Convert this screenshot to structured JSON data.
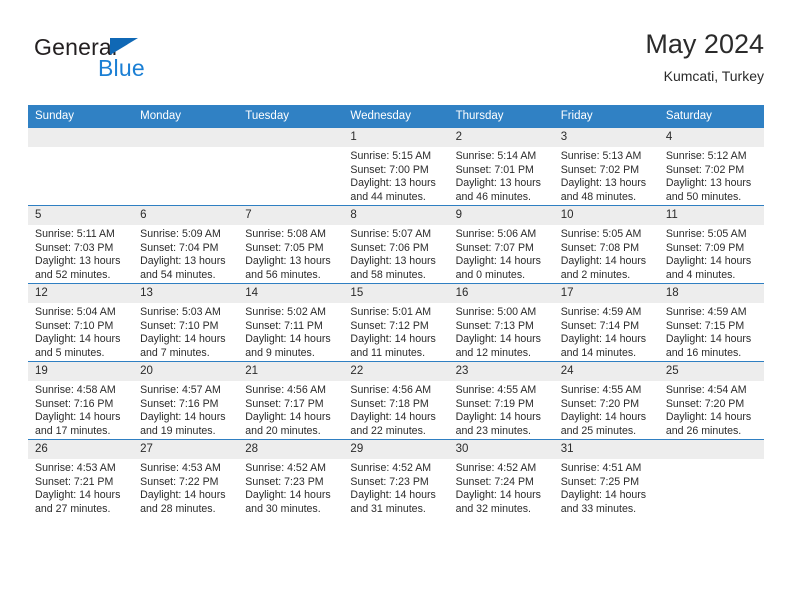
{
  "brand": {
    "name_top": "General",
    "name_bottom": "Blue",
    "accent_color": "#1b7fd4",
    "triangle_color": "#1068b5",
    "triangle_icon": "triangle-icon"
  },
  "header": {
    "title": "May 2024",
    "subtitle": "Kumcati, Turkey"
  },
  "calendar": {
    "header_bg": "#3081c4",
    "header_text_color": "#ffffff",
    "daynum_bg": "#ededed",
    "row_border_color": "#2f7fc2",
    "weekdays": [
      "Sunday",
      "Monday",
      "Tuesday",
      "Wednesday",
      "Thursday",
      "Friday",
      "Saturday"
    ],
    "weeks": [
      [
        {
          "day": "",
          "empty": true
        },
        {
          "day": "",
          "empty": true
        },
        {
          "day": "",
          "empty": true
        },
        {
          "day": "1",
          "sunrise": "Sunrise: 5:15 AM",
          "sunset": "Sunset: 7:00 PM",
          "daylight1": "Daylight: 13 hours",
          "daylight2": "and 44 minutes."
        },
        {
          "day": "2",
          "sunrise": "Sunrise: 5:14 AM",
          "sunset": "Sunset: 7:01 PM",
          "daylight1": "Daylight: 13 hours",
          "daylight2": "and 46 minutes."
        },
        {
          "day": "3",
          "sunrise": "Sunrise: 5:13 AM",
          "sunset": "Sunset: 7:02 PM",
          "daylight1": "Daylight: 13 hours",
          "daylight2": "and 48 minutes."
        },
        {
          "day": "4",
          "sunrise": "Sunrise: 5:12 AM",
          "sunset": "Sunset: 7:02 PM",
          "daylight1": "Daylight: 13 hours",
          "daylight2": "and 50 minutes."
        }
      ],
      [
        {
          "day": "5",
          "sunrise": "Sunrise: 5:11 AM",
          "sunset": "Sunset: 7:03 PM",
          "daylight1": "Daylight: 13 hours",
          "daylight2": "and 52 minutes."
        },
        {
          "day": "6",
          "sunrise": "Sunrise: 5:09 AM",
          "sunset": "Sunset: 7:04 PM",
          "daylight1": "Daylight: 13 hours",
          "daylight2": "and 54 minutes."
        },
        {
          "day": "7",
          "sunrise": "Sunrise: 5:08 AM",
          "sunset": "Sunset: 7:05 PM",
          "daylight1": "Daylight: 13 hours",
          "daylight2": "and 56 minutes."
        },
        {
          "day": "8",
          "sunrise": "Sunrise: 5:07 AM",
          "sunset": "Sunset: 7:06 PM",
          "daylight1": "Daylight: 13 hours",
          "daylight2": "and 58 minutes."
        },
        {
          "day": "9",
          "sunrise": "Sunrise: 5:06 AM",
          "sunset": "Sunset: 7:07 PM",
          "daylight1": "Daylight: 14 hours",
          "daylight2": "and 0 minutes."
        },
        {
          "day": "10",
          "sunrise": "Sunrise: 5:05 AM",
          "sunset": "Sunset: 7:08 PM",
          "daylight1": "Daylight: 14 hours",
          "daylight2": "and 2 minutes."
        },
        {
          "day": "11",
          "sunrise": "Sunrise: 5:05 AM",
          "sunset": "Sunset: 7:09 PM",
          "daylight1": "Daylight: 14 hours",
          "daylight2": "and 4 minutes."
        }
      ],
      [
        {
          "day": "12",
          "sunrise": "Sunrise: 5:04 AM",
          "sunset": "Sunset: 7:10 PM",
          "daylight1": "Daylight: 14 hours",
          "daylight2": "and 5 minutes."
        },
        {
          "day": "13",
          "sunrise": "Sunrise: 5:03 AM",
          "sunset": "Sunset: 7:10 PM",
          "daylight1": "Daylight: 14 hours",
          "daylight2": "and 7 minutes."
        },
        {
          "day": "14",
          "sunrise": "Sunrise: 5:02 AM",
          "sunset": "Sunset: 7:11 PM",
          "daylight1": "Daylight: 14 hours",
          "daylight2": "and 9 minutes."
        },
        {
          "day": "15",
          "sunrise": "Sunrise: 5:01 AM",
          "sunset": "Sunset: 7:12 PM",
          "daylight1": "Daylight: 14 hours",
          "daylight2": "and 11 minutes."
        },
        {
          "day": "16",
          "sunrise": "Sunrise: 5:00 AM",
          "sunset": "Sunset: 7:13 PM",
          "daylight1": "Daylight: 14 hours",
          "daylight2": "and 12 minutes."
        },
        {
          "day": "17",
          "sunrise": "Sunrise: 4:59 AM",
          "sunset": "Sunset: 7:14 PM",
          "daylight1": "Daylight: 14 hours",
          "daylight2": "and 14 minutes."
        },
        {
          "day": "18",
          "sunrise": "Sunrise: 4:59 AM",
          "sunset": "Sunset: 7:15 PM",
          "daylight1": "Daylight: 14 hours",
          "daylight2": "and 16 minutes."
        }
      ],
      [
        {
          "day": "19",
          "sunrise": "Sunrise: 4:58 AM",
          "sunset": "Sunset: 7:16 PM",
          "daylight1": "Daylight: 14 hours",
          "daylight2": "and 17 minutes."
        },
        {
          "day": "20",
          "sunrise": "Sunrise: 4:57 AM",
          "sunset": "Sunset: 7:16 PM",
          "daylight1": "Daylight: 14 hours",
          "daylight2": "and 19 minutes."
        },
        {
          "day": "21",
          "sunrise": "Sunrise: 4:56 AM",
          "sunset": "Sunset: 7:17 PM",
          "daylight1": "Daylight: 14 hours",
          "daylight2": "and 20 minutes."
        },
        {
          "day": "22",
          "sunrise": "Sunrise: 4:56 AM",
          "sunset": "Sunset: 7:18 PM",
          "daylight1": "Daylight: 14 hours",
          "daylight2": "and 22 minutes."
        },
        {
          "day": "23",
          "sunrise": "Sunrise: 4:55 AM",
          "sunset": "Sunset: 7:19 PM",
          "daylight1": "Daylight: 14 hours",
          "daylight2": "and 23 minutes."
        },
        {
          "day": "24",
          "sunrise": "Sunrise: 4:55 AM",
          "sunset": "Sunset: 7:20 PM",
          "daylight1": "Daylight: 14 hours",
          "daylight2": "and 25 minutes."
        },
        {
          "day": "25",
          "sunrise": "Sunrise: 4:54 AM",
          "sunset": "Sunset: 7:20 PM",
          "daylight1": "Daylight: 14 hours",
          "daylight2": "and 26 minutes."
        }
      ],
      [
        {
          "day": "26",
          "sunrise": "Sunrise: 4:53 AM",
          "sunset": "Sunset: 7:21 PM",
          "daylight1": "Daylight: 14 hours",
          "daylight2": "and 27 minutes."
        },
        {
          "day": "27",
          "sunrise": "Sunrise: 4:53 AM",
          "sunset": "Sunset: 7:22 PM",
          "daylight1": "Daylight: 14 hours",
          "daylight2": "and 28 minutes."
        },
        {
          "day": "28",
          "sunrise": "Sunrise: 4:52 AM",
          "sunset": "Sunset: 7:23 PM",
          "daylight1": "Daylight: 14 hours",
          "daylight2": "and 30 minutes."
        },
        {
          "day": "29",
          "sunrise": "Sunrise: 4:52 AM",
          "sunset": "Sunset: 7:23 PM",
          "daylight1": "Daylight: 14 hours",
          "daylight2": "and 31 minutes."
        },
        {
          "day": "30",
          "sunrise": "Sunrise: 4:52 AM",
          "sunset": "Sunset: 7:24 PM",
          "daylight1": "Daylight: 14 hours",
          "daylight2": "and 32 minutes."
        },
        {
          "day": "31",
          "sunrise": "Sunrise: 4:51 AM",
          "sunset": "Sunset: 7:25 PM",
          "daylight1": "Daylight: 14 hours",
          "daylight2": "and 33 minutes."
        },
        {
          "day": "",
          "empty": true
        }
      ]
    ]
  }
}
